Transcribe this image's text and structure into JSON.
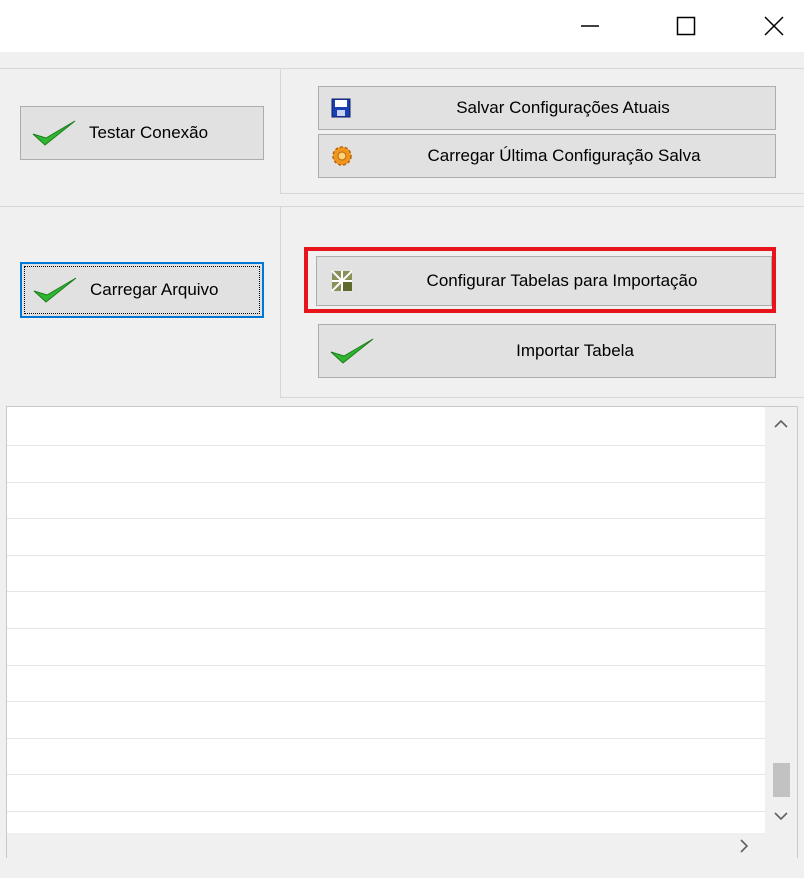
{
  "window": {
    "minimize_icon": "minimize-icon",
    "maximize_icon": "maximize-icon",
    "close_icon": "close-icon"
  },
  "connection_group": {
    "test_button": {
      "label": "Testar Conexão",
      "icon": "green-checkmark-icon"
    },
    "save_button": {
      "label": "Salvar Configurações Atuais",
      "icon": "floppy-disk-icon"
    },
    "load_button": {
      "label": "Carregar Última Configuração Salva",
      "icon": "orange-gear-icon"
    }
  },
  "import_group": {
    "load_file_button": {
      "label": "Carregar Arquivo",
      "icon": "green-checkmark-icon"
    },
    "configure_tables_button": {
      "label": "Configurar Tabelas para Importação",
      "icon": "table-grid-icon"
    },
    "import_table_button": {
      "label": "Importar Tabela",
      "icon": "green-checkmark-icon"
    }
  },
  "log": {
    "lines": [
      "",
      "",
      "",
      "",
      "",
      "",
      "",
      "",
      "",
      "",
      ""
    ]
  },
  "colors": {
    "highlight": "#e8141b",
    "focus": "#0078d7",
    "button_face": "#e1e1e1",
    "window_bg": "#f0f0f0"
  }
}
